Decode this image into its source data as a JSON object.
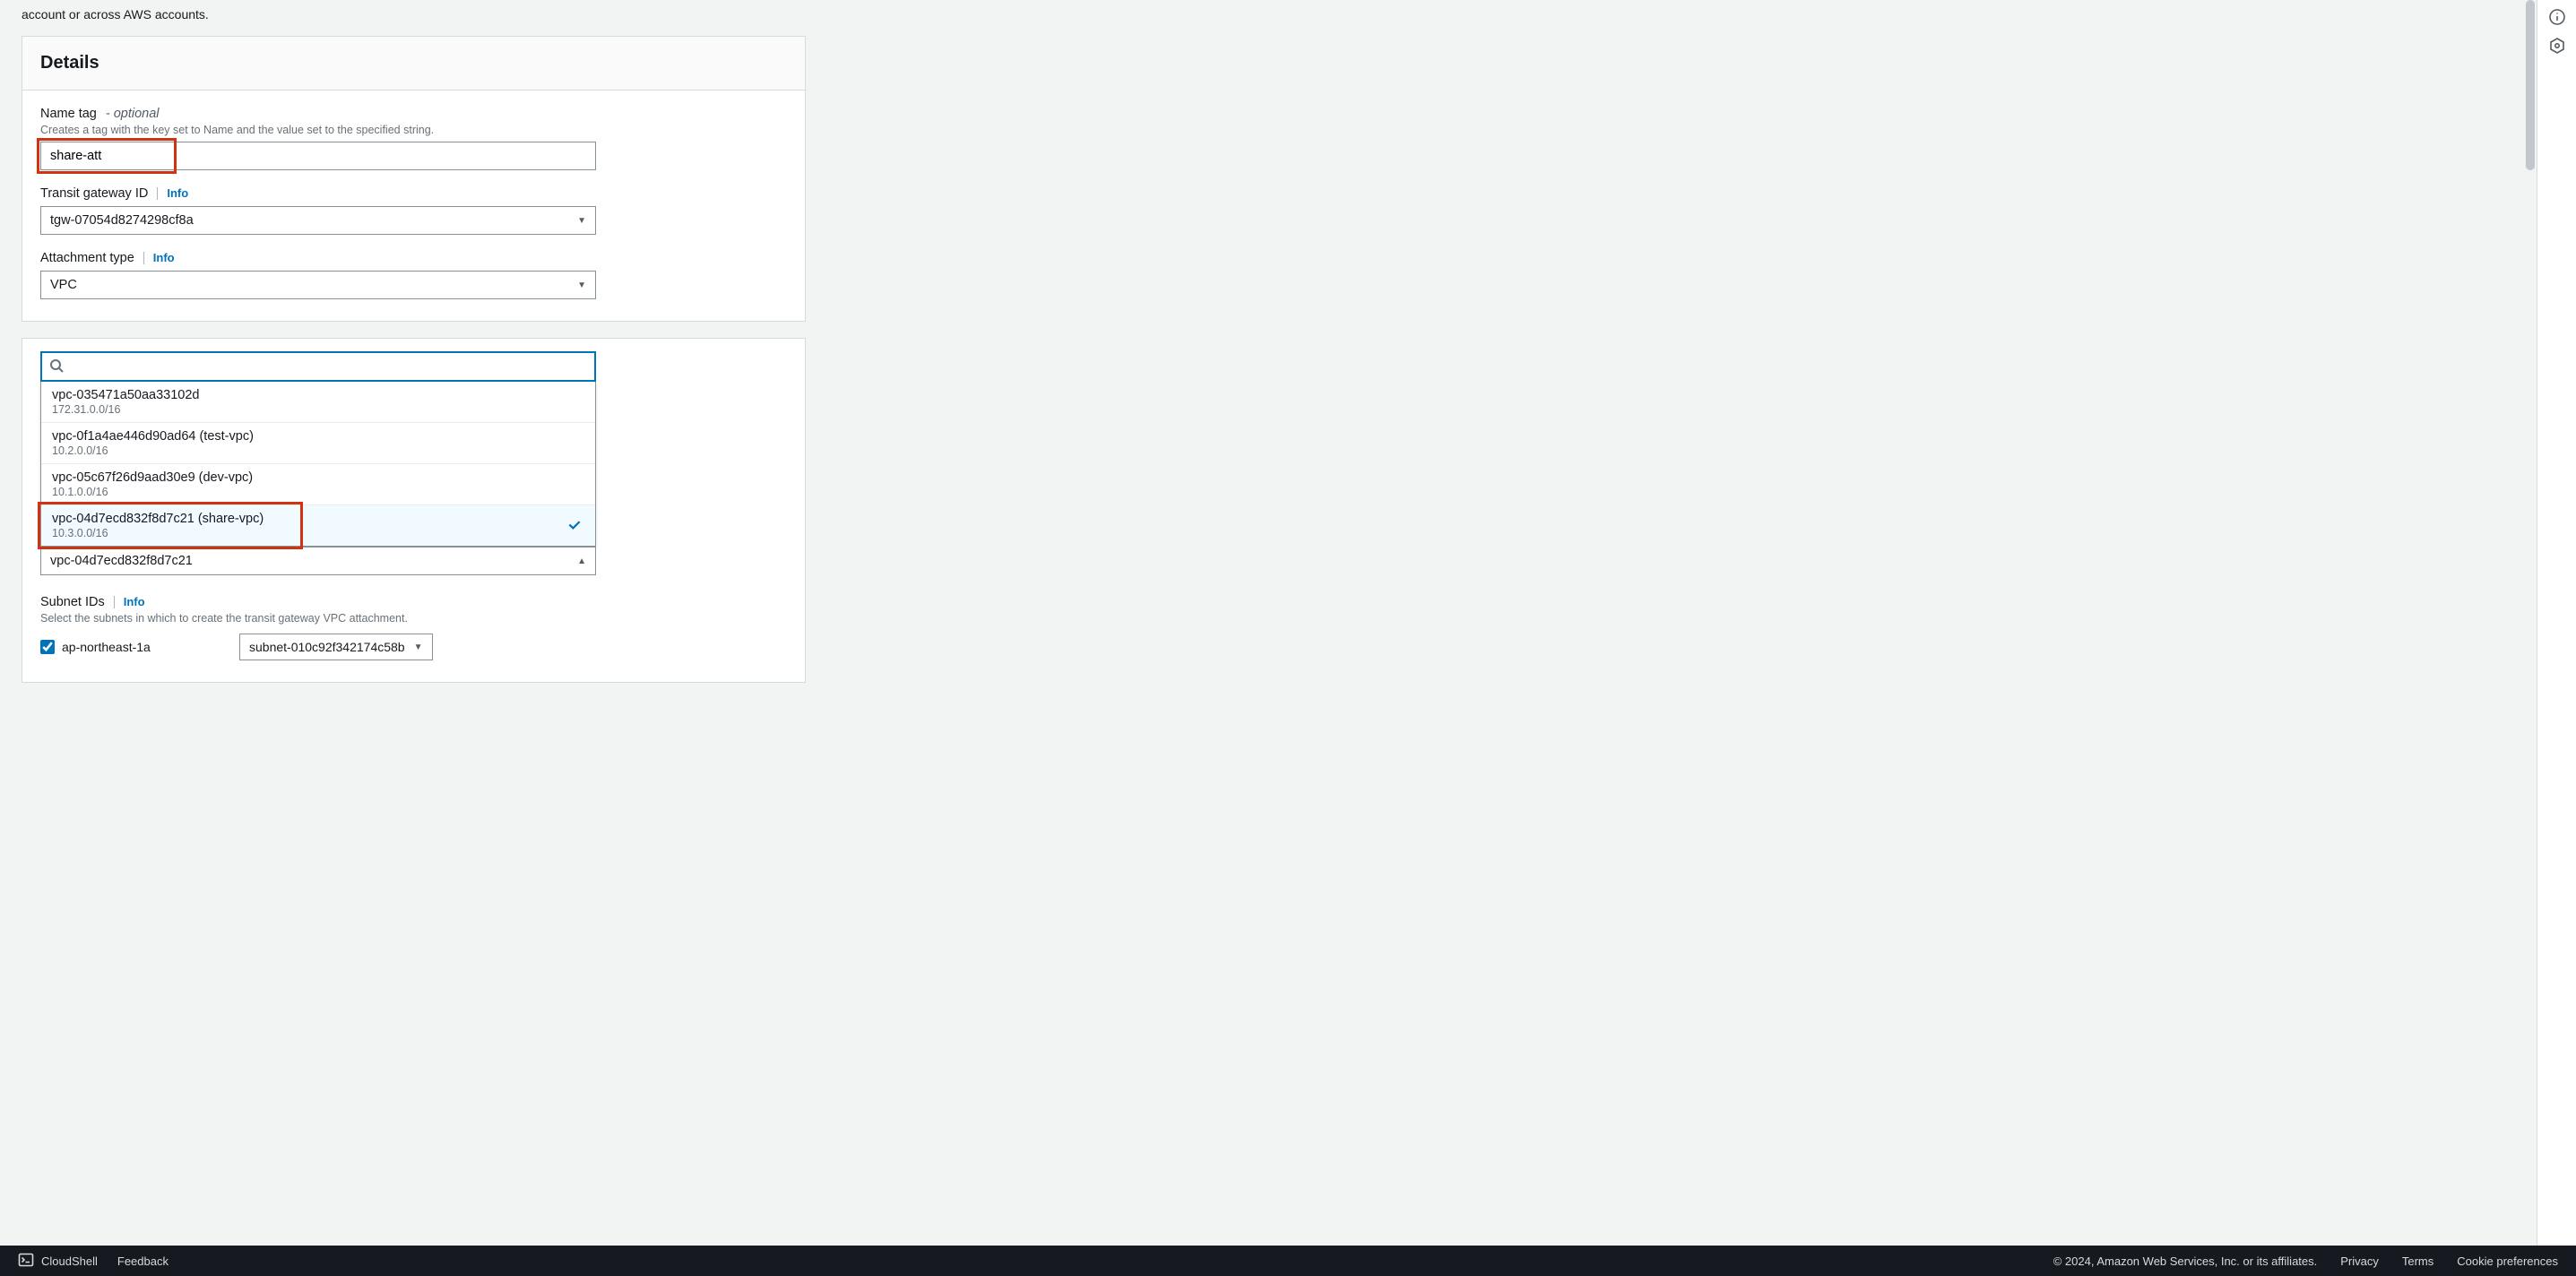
{
  "intro_tail": "account or across AWS accounts.",
  "details": {
    "title": "Details",
    "name_tag": {
      "label": "Name tag",
      "optional_suffix": "- optional",
      "help": "Creates a tag with the key set to Name and the value set to the specified string.",
      "value": "share-att"
    },
    "tgw": {
      "label": "Transit gateway ID",
      "info": "Info",
      "value": "tgw-07054d8274298cf8a"
    },
    "attachment_type": {
      "label": "Attachment type",
      "info": "Info",
      "value": "VPC"
    }
  },
  "vpc_picker": {
    "search_value": "",
    "options": [
      {
        "label": "vpc-035471a50aa33102d",
        "sub": "172.31.0.0/16",
        "selected": false
      },
      {
        "label": "vpc-0f1a4ae446d90ad64 (test-vpc)",
        "sub": "10.2.0.0/16",
        "selected": false
      },
      {
        "label": "vpc-05c67f26d9aad30e9 (dev-vpc)",
        "sub": "10.1.0.0/16",
        "selected": false
      },
      {
        "label": "vpc-04d7ecd832f8d7c21 (share-vpc)",
        "sub": "10.3.0.0/16",
        "selected": true
      }
    ],
    "collapsed_value": "vpc-04d7ecd832f8d7c21"
  },
  "subnets": {
    "label": "Subnet IDs",
    "info": "Info",
    "help": "Select the subnets in which to create the transit gateway VPC attachment.",
    "rows": [
      {
        "az": "ap-northeast-1a",
        "checked": true,
        "subnet": "subnet-010c92f342174c58b"
      }
    ]
  },
  "footer": {
    "cloudshell": "CloudShell",
    "feedback": "Feedback",
    "copyright": "© 2024, Amazon Web Services, Inc. or its affiliates.",
    "privacy": "Privacy",
    "terms": "Terms",
    "cookies": "Cookie preferences"
  }
}
